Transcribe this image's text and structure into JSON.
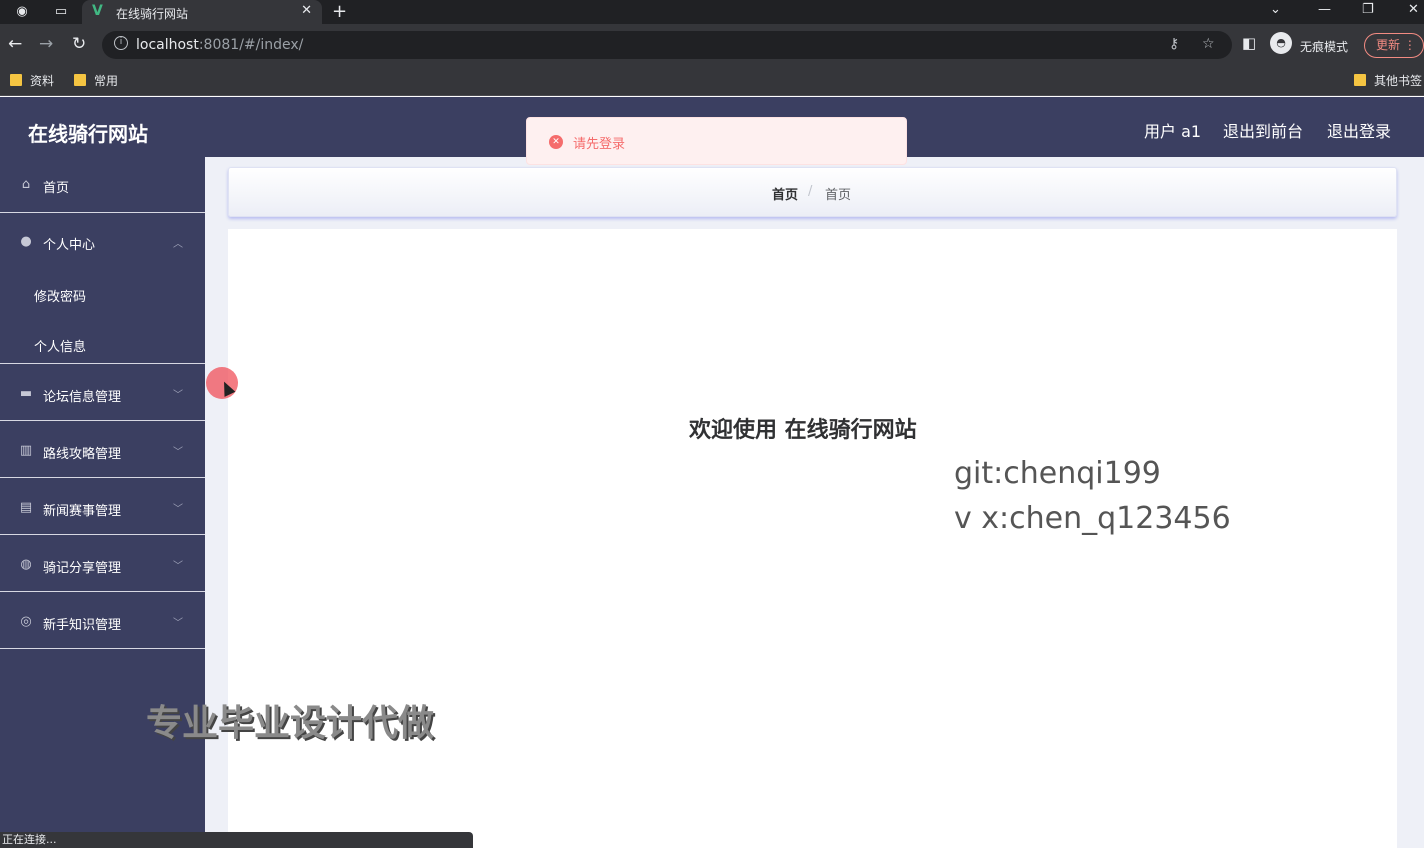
{
  "browser": {
    "tab_title": "在线骑行网站",
    "tab_favicon": "V",
    "url_host": "localhost",
    "url_rest": ":8081/#/index/",
    "incognito_label": "无痕模式",
    "update_label": "更新",
    "bookmarks": [
      {
        "label": "资料"
      },
      {
        "label": "常用"
      },
      {
        "label": "其他书签"
      }
    ],
    "status_text": "正在连接..."
  },
  "header": {
    "title": "在线骑行网站",
    "user_label": "用户 a1",
    "exit_front_label": "退出到前台",
    "logout_label": "退出登录"
  },
  "sidebar": {
    "items": [
      {
        "label": "首页",
        "icon": "home-icon"
      },
      {
        "label": "个人中心",
        "icon": "user-icon",
        "expanded": true,
        "children": [
          {
            "label": "修改密码"
          },
          {
            "label": "个人信息"
          }
        ]
      },
      {
        "label": "论坛信息管理",
        "icon": "briefcase-icon"
      },
      {
        "label": "路线攻略管理",
        "icon": "chart-icon"
      },
      {
        "label": "新闻赛事管理",
        "icon": "message-icon"
      },
      {
        "label": "骑记分享管理",
        "icon": "bulb-icon"
      },
      {
        "label": "新手知识管理",
        "icon": "compass-icon"
      }
    ]
  },
  "breadcrumb": {
    "root": "首页",
    "separator": "/",
    "current": "首页"
  },
  "toast": {
    "message": "请先登录",
    "type": "error"
  },
  "main": {
    "welcome": "欢迎使用 在线骑行网站"
  },
  "overlay": {
    "line1": "git:chenqi199",
    "line2": "v x:chen_q123456",
    "watermark": "专业毕业设计代做"
  },
  "colors": {
    "sidebar_bg": "#3b3f61",
    "error": "#f56c6c",
    "toast_bg": "#fef0f0"
  }
}
